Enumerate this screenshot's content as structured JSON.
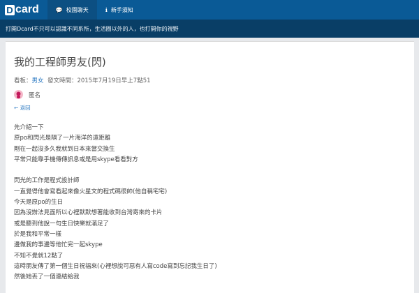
{
  "app": {
    "logo_text": "card"
  },
  "nav": {
    "tabs": [
      {
        "icon": "chat-icon",
        "label": "校園聊天"
      },
      {
        "icon": "info-icon",
        "label": "新手須知"
      }
    ]
  },
  "banner": {
    "text": "打開Dcard不只可以認識不同系所，生活圈以外的人，也打開你的視野"
  },
  "post": {
    "title": "我的工程師男友(閃)",
    "board_prefix": "看板：",
    "board": "男女",
    "time_label": "發文時間：2015年7月19日早上7點51",
    "author": "匿名",
    "back_label": "返回",
    "body_lines": [
      "先介紹一下",
      "原po和閃光是隔了一片海洋的遠距離",
      "剛在一起沒多久我就到日本來當交換生",
      "平常只能靠手機傳傳訊息或是用skype看看對方",
      "",
      "閃光的工作是程式設計師",
      "一直覺得他會寫看起來像火星文的程式碼很帥(他自稱宅宅)",
      "今天是原po的生日",
      "因為沒辦法見面所以心裡默默想著能收到台灣寄來的卡片",
      "或是聽到他說一句生日快樂就滿足了",
      "於是我和平常一樣",
      "邊做我的事邊等他忙完一起skype",
      "不知不覺就12點了",
      "這時朋友傳了第一個生日祝福來(心裡想說可惡有人寫code寫到忘記我生日了)",
      "然後她丟了一個連結給我"
    ]
  },
  "colors": {
    "topbar": "#0a5a96",
    "banner": "#093e66",
    "link": "#2b79c2"
  }
}
